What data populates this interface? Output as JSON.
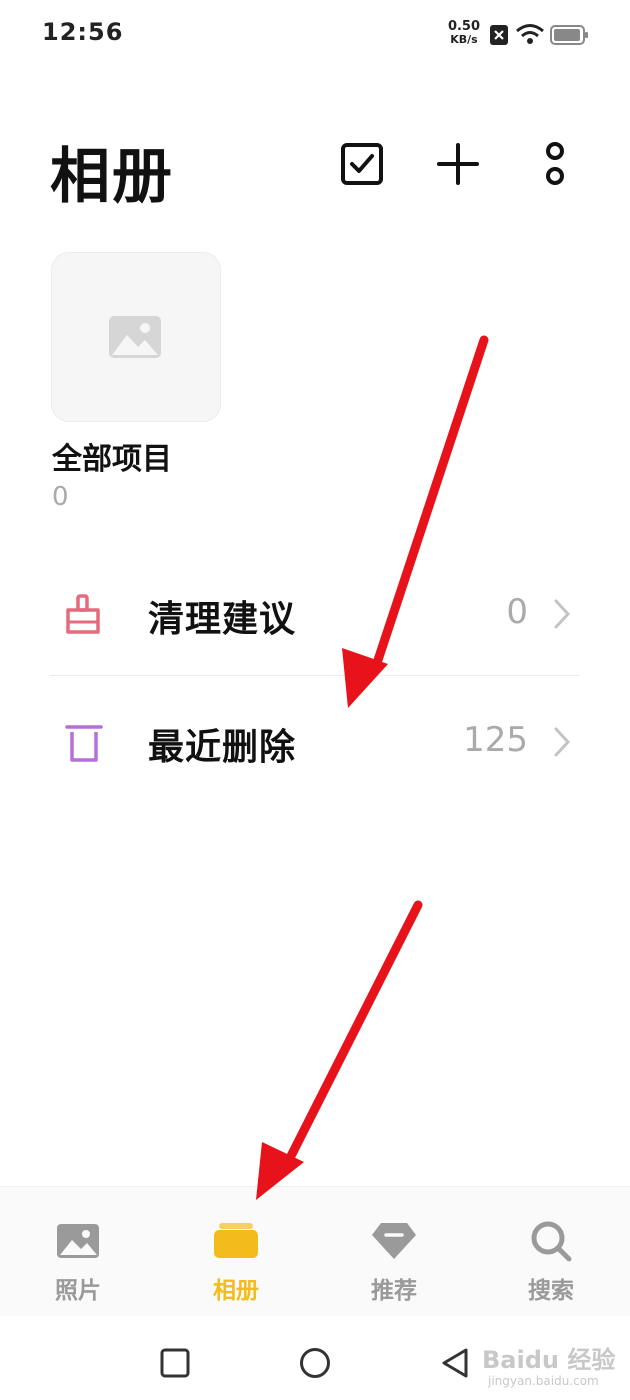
{
  "status_bar": {
    "time": "12:56",
    "net_speed": "0.50",
    "net_unit": "KB/s",
    "icons": [
      "sim-x-icon",
      "wifi-icon",
      "battery-icon"
    ]
  },
  "header": {
    "title": "相册",
    "actions": [
      "select-checkbox-icon",
      "add-icon",
      "more-vertical-icon"
    ]
  },
  "albums": [
    {
      "name": "全部项目",
      "count": "0"
    }
  ],
  "list": [
    {
      "label": "清理建议",
      "count": "0",
      "icon": "broom-icon",
      "icon_color": "#e46a7c"
    },
    {
      "label": "最近删除",
      "count": "125",
      "icon": "trash-icon",
      "icon_color": "#b66fd4"
    }
  ],
  "bottom_nav": {
    "active_color": "#f2bd1c",
    "items": [
      {
        "label": "照片",
        "icon": "photo-icon",
        "active": false
      },
      {
        "label": "相册",
        "icon": "album-icon",
        "active": true
      },
      {
        "label": "推荐",
        "icon": "gem-icon",
        "active": false
      },
      {
        "label": "搜索",
        "icon": "search-icon",
        "active": false
      }
    ]
  },
  "system_nav": [
    "recents-square-icon",
    "home-circle-icon",
    "back-triangle-icon"
  ],
  "annotations": {
    "arrow_color": "#e8121b"
  },
  "watermark": {
    "text": "Baidu 经验",
    "sub": "jingyan.baidu.com"
  }
}
